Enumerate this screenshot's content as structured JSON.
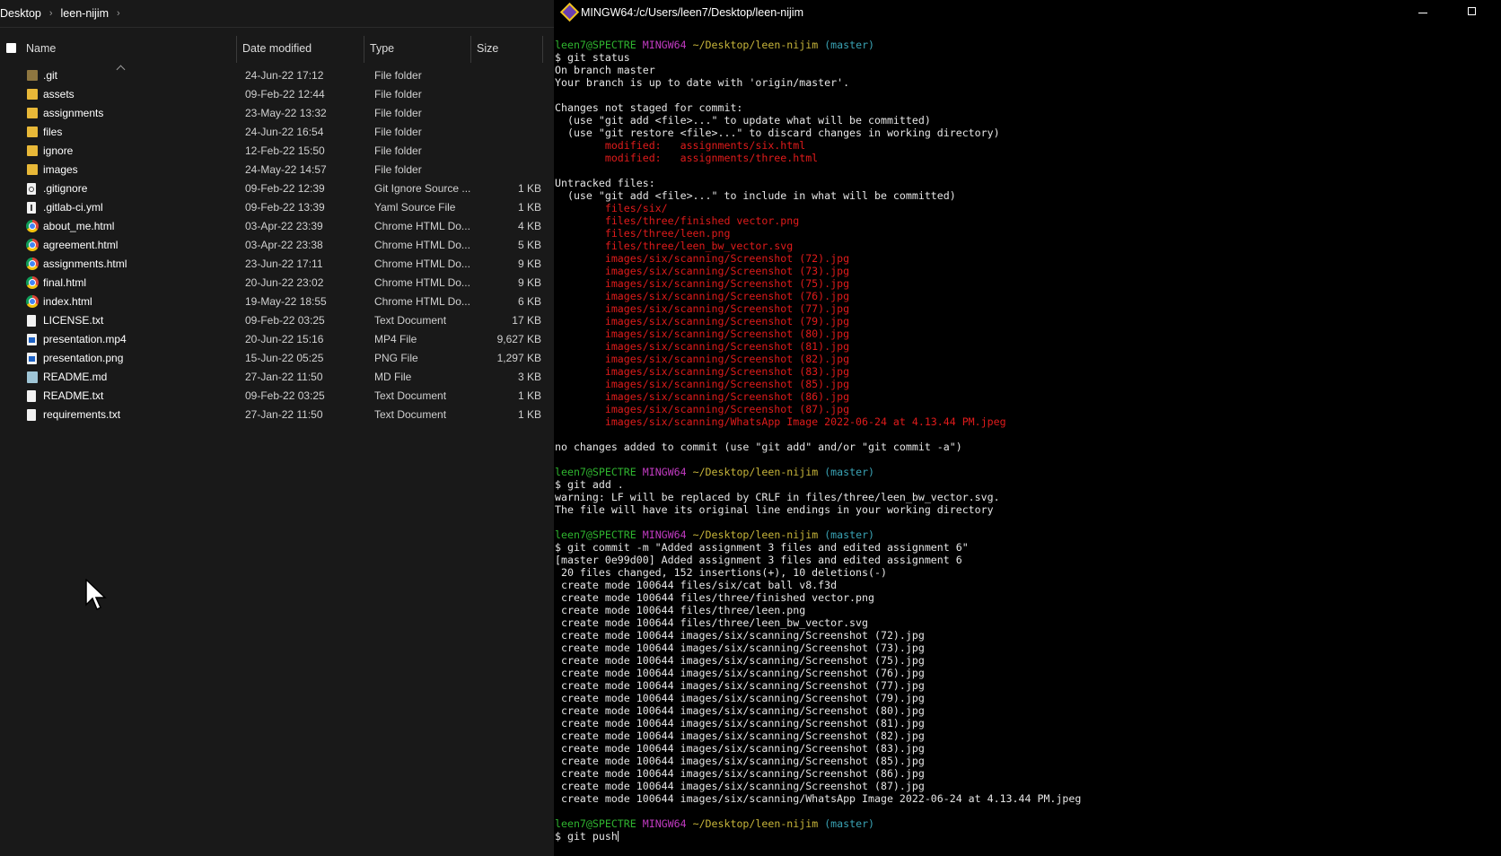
{
  "explorer": {
    "breadcrumb": [
      "Desktop",
      "leen-nijim"
    ],
    "columns": {
      "name": "Name",
      "date": "Date modified",
      "type": "Type",
      "size": "Size"
    },
    "files": [
      {
        "name": ".git",
        "date": "24-Jun-22 17:12",
        "type": "File folder",
        "size": "",
        "icon": "folder-dim"
      },
      {
        "name": "assets",
        "date": "09-Feb-22 12:44",
        "type": "File folder",
        "size": "",
        "icon": "folder"
      },
      {
        "name": "assignments",
        "date": "23-May-22 13:32",
        "type": "File folder",
        "size": "",
        "icon": "folder"
      },
      {
        "name": "files",
        "date": "24-Jun-22 16:54",
        "type": "File folder",
        "size": "",
        "icon": "folder"
      },
      {
        "name": "ignore",
        "date": "12-Feb-22 15:50",
        "type": "File folder",
        "size": "",
        "icon": "folder"
      },
      {
        "name": "images",
        "date": "24-May-22 14:57",
        "type": "File folder",
        "size": "",
        "icon": "folder"
      },
      {
        "name": ".gitignore",
        "date": "09-Feb-22 12:39",
        "type": "Git Ignore Source ...",
        "size": "1 KB",
        "icon": "gear-doc"
      },
      {
        "name": ".gitlab-ci.yml",
        "date": "09-Feb-22 13:39",
        "type": "Yaml Source File",
        "size": "1 KB",
        "icon": "yaml-doc"
      },
      {
        "name": "about_me.html",
        "date": "03-Apr-22 23:39",
        "type": "Chrome HTML Do...",
        "size": "4 KB",
        "icon": "chrome"
      },
      {
        "name": "agreement.html",
        "date": "03-Apr-22 23:38",
        "type": "Chrome HTML Do...",
        "size": "5 KB",
        "icon": "chrome"
      },
      {
        "name": "assignments.html",
        "date": "23-Jun-22 17:11",
        "type": "Chrome HTML Do...",
        "size": "9 KB",
        "icon": "chrome"
      },
      {
        "name": "final.html",
        "date": "20-Jun-22 23:02",
        "type": "Chrome HTML Do...",
        "size": "9 KB",
        "icon": "chrome"
      },
      {
        "name": "index.html",
        "date": "19-May-22 18:55",
        "type": "Chrome HTML Do...",
        "size": "6 KB",
        "icon": "chrome"
      },
      {
        "name": "LICENSE.txt",
        "date": "09-Feb-22 03:25",
        "type": "Text Document",
        "size": "17 KB",
        "icon": "doc"
      },
      {
        "name": "presentation.mp4",
        "date": "20-Jun-22 15:16",
        "type": "MP4 File",
        "size": "9,627 KB",
        "icon": "media"
      },
      {
        "name": "presentation.png",
        "date": "15-Jun-22 05:25",
        "type": "PNG File",
        "size": "1,297 KB",
        "icon": "media"
      },
      {
        "name": "README.md",
        "date": "27-Jan-22 11:50",
        "type": "MD File",
        "size": "3 KB",
        "icon": "md"
      },
      {
        "name": "README.txt",
        "date": "09-Feb-22 03:25",
        "type": "Text Document",
        "size": "1 KB",
        "icon": "doc"
      },
      {
        "name": "requirements.txt",
        "date": "27-Jan-22 11:50",
        "type": "Text Document",
        "size": "1 KB",
        "icon": "doc"
      }
    ]
  },
  "terminal": {
    "title": "MINGW64:/c/Users/leen7/Desktop/leen-nijim",
    "colors": {
      "user": "#2fb52f",
      "shell": "#c23bc2",
      "path": "#c7b53a",
      "branch": "#3aa3b5",
      "error": "#e01b1b",
      "text": "#e6e6e6"
    },
    "lines": [
      {
        "segs": [
          {
            "t": "leen7@SPECTRE",
            "c": "green"
          },
          {
            "t": " ",
            "c": "white"
          },
          {
            "t": "MINGW64",
            "c": "magenta"
          },
          {
            "t": " ",
            "c": "white"
          },
          {
            "t": "~/Desktop/leen-nijim",
            "c": "yellow"
          },
          {
            "t": " ",
            "c": "white"
          },
          {
            "t": "(master)",
            "c": "cyan"
          }
        ]
      },
      {
        "segs": [
          {
            "t": "$ git status",
            "c": "white"
          }
        ]
      },
      {
        "segs": [
          {
            "t": "On branch master",
            "c": "white"
          }
        ]
      },
      {
        "segs": [
          {
            "t": "Your branch is up to date with 'origin/master'.",
            "c": "white"
          }
        ]
      },
      {
        "segs": [
          {
            "t": "",
            "c": "white"
          }
        ]
      },
      {
        "segs": [
          {
            "t": "Changes not staged for commit:",
            "c": "white"
          }
        ]
      },
      {
        "segs": [
          {
            "t": "  (use \"git add <file>...\" to update what will be committed)",
            "c": "white"
          }
        ]
      },
      {
        "segs": [
          {
            "t": "  (use \"git restore <file>...\" to discard changes in working directory)",
            "c": "white"
          }
        ]
      },
      {
        "segs": [
          {
            "t": "        modified:   assignments/six.html",
            "c": "red"
          }
        ]
      },
      {
        "segs": [
          {
            "t": "        modified:   assignments/three.html",
            "c": "red"
          }
        ]
      },
      {
        "segs": [
          {
            "t": "",
            "c": "white"
          }
        ]
      },
      {
        "segs": [
          {
            "t": "Untracked files:",
            "c": "white"
          }
        ]
      },
      {
        "segs": [
          {
            "t": "  (use \"git add <file>...\" to include in what will be committed)",
            "c": "white"
          }
        ]
      },
      {
        "segs": [
          {
            "t": "        files/six/",
            "c": "red"
          }
        ]
      },
      {
        "segs": [
          {
            "t": "        files/three/finished vector.png",
            "c": "red"
          }
        ]
      },
      {
        "segs": [
          {
            "t": "        files/three/leen.png",
            "c": "red"
          }
        ]
      },
      {
        "segs": [
          {
            "t": "        files/three/leen_bw_vector.svg",
            "c": "red"
          }
        ]
      },
      {
        "segs": [
          {
            "t": "        images/six/scanning/Screenshot (72).jpg",
            "c": "red"
          }
        ]
      },
      {
        "segs": [
          {
            "t": "        images/six/scanning/Screenshot (73).jpg",
            "c": "red"
          }
        ]
      },
      {
        "segs": [
          {
            "t": "        images/six/scanning/Screenshot (75).jpg",
            "c": "red"
          }
        ]
      },
      {
        "segs": [
          {
            "t": "        images/six/scanning/Screenshot (76).jpg",
            "c": "red"
          }
        ]
      },
      {
        "segs": [
          {
            "t": "        images/six/scanning/Screenshot (77).jpg",
            "c": "red"
          }
        ]
      },
      {
        "segs": [
          {
            "t": "        images/six/scanning/Screenshot (79).jpg",
            "c": "red"
          }
        ]
      },
      {
        "segs": [
          {
            "t": "        images/six/scanning/Screenshot (80).jpg",
            "c": "red"
          }
        ]
      },
      {
        "segs": [
          {
            "t": "        images/six/scanning/Screenshot (81).jpg",
            "c": "red"
          }
        ]
      },
      {
        "segs": [
          {
            "t": "        images/six/scanning/Screenshot (82).jpg",
            "c": "red"
          }
        ]
      },
      {
        "segs": [
          {
            "t": "        images/six/scanning/Screenshot (83).jpg",
            "c": "red"
          }
        ]
      },
      {
        "segs": [
          {
            "t": "        images/six/scanning/Screenshot (85).jpg",
            "c": "red"
          }
        ]
      },
      {
        "segs": [
          {
            "t": "        images/six/scanning/Screenshot (86).jpg",
            "c": "red"
          }
        ]
      },
      {
        "segs": [
          {
            "t": "        images/six/scanning/Screenshot (87).jpg",
            "c": "red"
          }
        ]
      },
      {
        "segs": [
          {
            "t": "        images/six/scanning/WhatsApp Image 2022-06-24 at 4.13.44 PM.jpeg",
            "c": "red"
          }
        ]
      },
      {
        "segs": [
          {
            "t": "",
            "c": "white"
          }
        ]
      },
      {
        "segs": [
          {
            "t": "no changes added to commit (use \"git add\" and/or \"git commit -a\")",
            "c": "white"
          }
        ]
      },
      {
        "segs": [
          {
            "t": "",
            "c": "white"
          }
        ]
      },
      {
        "segs": [
          {
            "t": "leen7@SPECTRE",
            "c": "green"
          },
          {
            "t": " ",
            "c": "white"
          },
          {
            "t": "MINGW64",
            "c": "magenta"
          },
          {
            "t": " ",
            "c": "white"
          },
          {
            "t": "~/Desktop/leen-nijim",
            "c": "yellow"
          },
          {
            "t": " ",
            "c": "white"
          },
          {
            "t": "(master)",
            "c": "cyan"
          }
        ]
      },
      {
        "segs": [
          {
            "t": "$ git add .",
            "c": "white"
          }
        ]
      },
      {
        "segs": [
          {
            "t": "warning: LF will be replaced by CRLF in files/three/leen_bw_vector.svg.",
            "c": "white"
          }
        ]
      },
      {
        "segs": [
          {
            "t": "The file will have its original line endings in your working directory",
            "c": "white"
          }
        ]
      },
      {
        "segs": [
          {
            "t": "",
            "c": "white"
          }
        ]
      },
      {
        "segs": [
          {
            "t": "leen7@SPECTRE",
            "c": "green"
          },
          {
            "t": " ",
            "c": "white"
          },
          {
            "t": "MINGW64",
            "c": "magenta"
          },
          {
            "t": " ",
            "c": "white"
          },
          {
            "t": "~/Desktop/leen-nijim",
            "c": "yellow"
          },
          {
            "t": " ",
            "c": "white"
          },
          {
            "t": "(master)",
            "c": "cyan"
          }
        ]
      },
      {
        "segs": [
          {
            "t": "$ git commit -m \"Added assignment 3 files and edited assignment 6\"",
            "c": "white"
          }
        ]
      },
      {
        "segs": [
          {
            "t": "[master 0e99d00] Added assignment 3 files and edited assignment 6",
            "c": "white"
          }
        ]
      },
      {
        "segs": [
          {
            "t": " 20 files changed, 152 insertions(+), 10 deletions(-)",
            "c": "white"
          }
        ]
      },
      {
        "segs": [
          {
            "t": " create mode 100644 files/six/cat ball v8.f3d",
            "c": "white"
          }
        ]
      },
      {
        "segs": [
          {
            "t": " create mode 100644 files/three/finished vector.png",
            "c": "white"
          }
        ]
      },
      {
        "segs": [
          {
            "t": " create mode 100644 files/three/leen.png",
            "c": "white"
          }
        ]
      },
      {
        "segs": [
          {
            "t": " create mode 100644 files/three/leen_bw_vector.svg",
            "c": "white"
          }
        ]
      },
      {
        "segs": [
          {
            "t": " create mode 100644 images/six/scanning/Screenshot (72).jpg",
            "c": "white"
          }
        ]
      },
      {
        "segs": [
          {
            "t": " create mode 100644 images/six/scanning/Screenshot (73).jpg",
            "c": "white"
          }
        ]
      },
      {
        "segs": [
          {
            "t": " create mode 100644 images/six/scanning/Screenshot (75).jpg",
            "c": "white"
          }
        ]
      },
      {
        "segs": [
          {
            "t": " create mode 100644 images/six/scanning/Screenshot (76).jpg",
            "c": "white"
          }
        ]
      },
      {
        "segs": [
          {
            "t": " create mode 100644 images/six/scanning/Screenshot (77).jpg",
            "c": "white"
          }
        ]
      },
      {
        "segs": [
          {
            "t": " create mode 100644 images/six/scanning/Screenshot (79).jpg",
            "c": "white"
          }
        ]
      },
      {
        "segs": [
          {
            "t": " create mode 100644 images/six/scanning/Screenshot (80).jpg",
            "c": "white"
          }
        ]
      },
      {
        "segs": [
          {
            "t": " create mode 100644 images/six/scanning/Screenshot (81).jpg",
            "c": "white"
          }
        ]
      },
      {
        "segs": [
          {
            "t": " create mode 100644 images/six/scanning/Screenshot (82).jpg",
            "c": "white"
          }
        ]
      },
      {
        "segs": [
          {
            "t": " create mode 100644 images/six/scanning/Screenshot (83).jpg",
            "c": "white"
          }
        ]
      },
      {
        "segs": [
          {
            "t": " create mode 100644 images/six/scanning/Screenshot (85).jpg",
            "c": "white"
          }
        ]
      },
      {
        "segs": [
          {
            "t": " create mode 100644 images/six/scanning/Screenshot (86).jpg",
            "c": "white"
          }
        ]
      },
      {
        "segs": [
          {
            "t": " create mode 100644 images/six/scanning/Screenshot (87).jpg",
            "c": "white"
          }
        ]
      },
      {
        "segs": [
          {
            "t": " create mode 100644 images/six/scanning/WhatsApp Image 2022-06-24 at 4.13.44 PM.jpeg",
            "c": "white"
          }
        ]
      },
      {
        "segs": [
          {
            "t": "",
            "c": "white"
          }
        ]
      },
      {
        "segs": [
          {
            "t": "leen7@SPECTRE",
            "c": "green"
          },
          {
            "t": " ",
            "c": "white"
          },
          {
            "t": "MINGW64",
            "c": "magenta"
          },
          {
            "t": " ",
            "c": "white"
          },
          {
            "t": "~/Desktop/leen-nijim",
            "c": "yellow"
          },
          {
            "t": " ",
            "c": "white"
          },
          {
            "t": "(master)",
            "c": "cyan"
          }
        ]
      },
      {
        "segs": [
          {
            "t": "$ git push",
            "c": "white"
          }
        ],
        "caret": true
      }
    ]
  }
}
